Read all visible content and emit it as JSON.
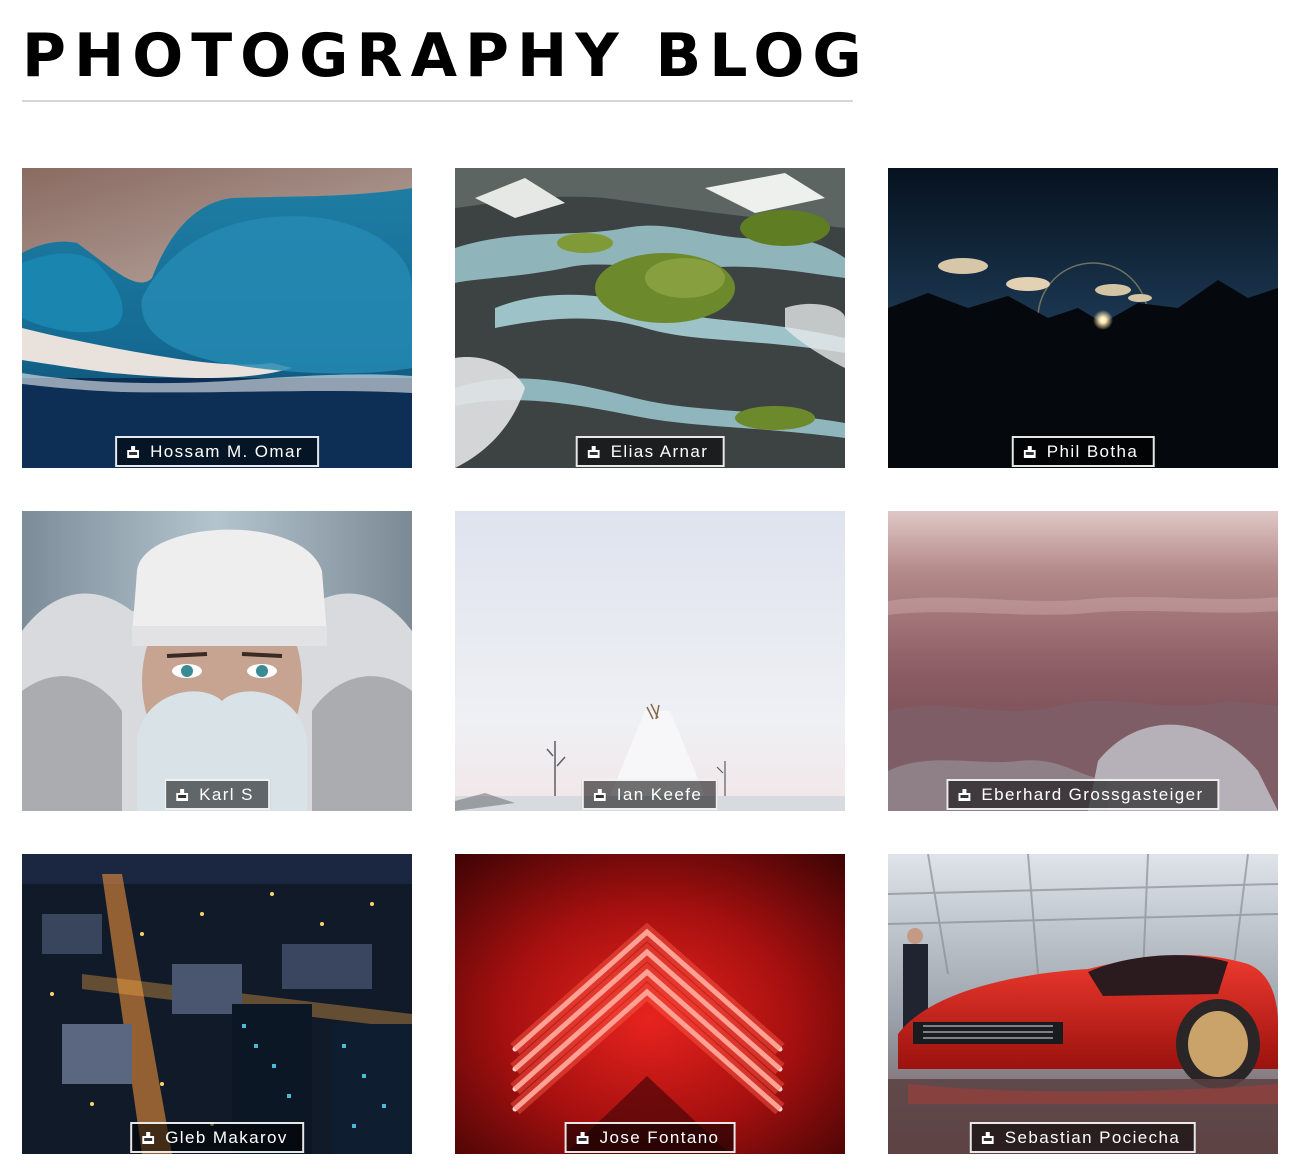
{
  "blog": {
    "title": "PHOTOGRAPHY BLOG"
  },
  "photos": [
    {
      "photographer": "Hossam M. Omar",
      "icon": "camera-icon",
      "subject": "aerial coastline"
    },
    {
      "photographer": "Elias Arnar",
      "icon": "camera-icon",
      "subject": "aerial river landscape"
    },
    {
      "photographer": "Phil Botha",
      "icon": "camera-icon",
      "subject": "mountain sunset"
    },
    {
      "photographer": "Karl S",
      "icon": "camera-icon",
      "subject": "portrait in winter hat"
    },
    {
      "photographer": "Ian Keefe",
      "icon": "camera-icon",
      "subject": "tipi in snow"
    },
    {
      "photographer": "Eberhard Grossgasteiger",
      "icon": "camera-icon",
      "subject": "waves close-up"
    },
    {
      "photographer": "Gleb Makarov",
      "icon": "camera-icon",
      "subject": "city at night"
    },
    {
      "photographer": "Jose Fontano",
      "icon": "camera-icon",
      "subject": "red neon chevrons"
    },
    {
      "photographer": "Sebastian Pociecha",
      "icon": "camera-icon",
      "subject": "red sports car"
    }
  ]
}
